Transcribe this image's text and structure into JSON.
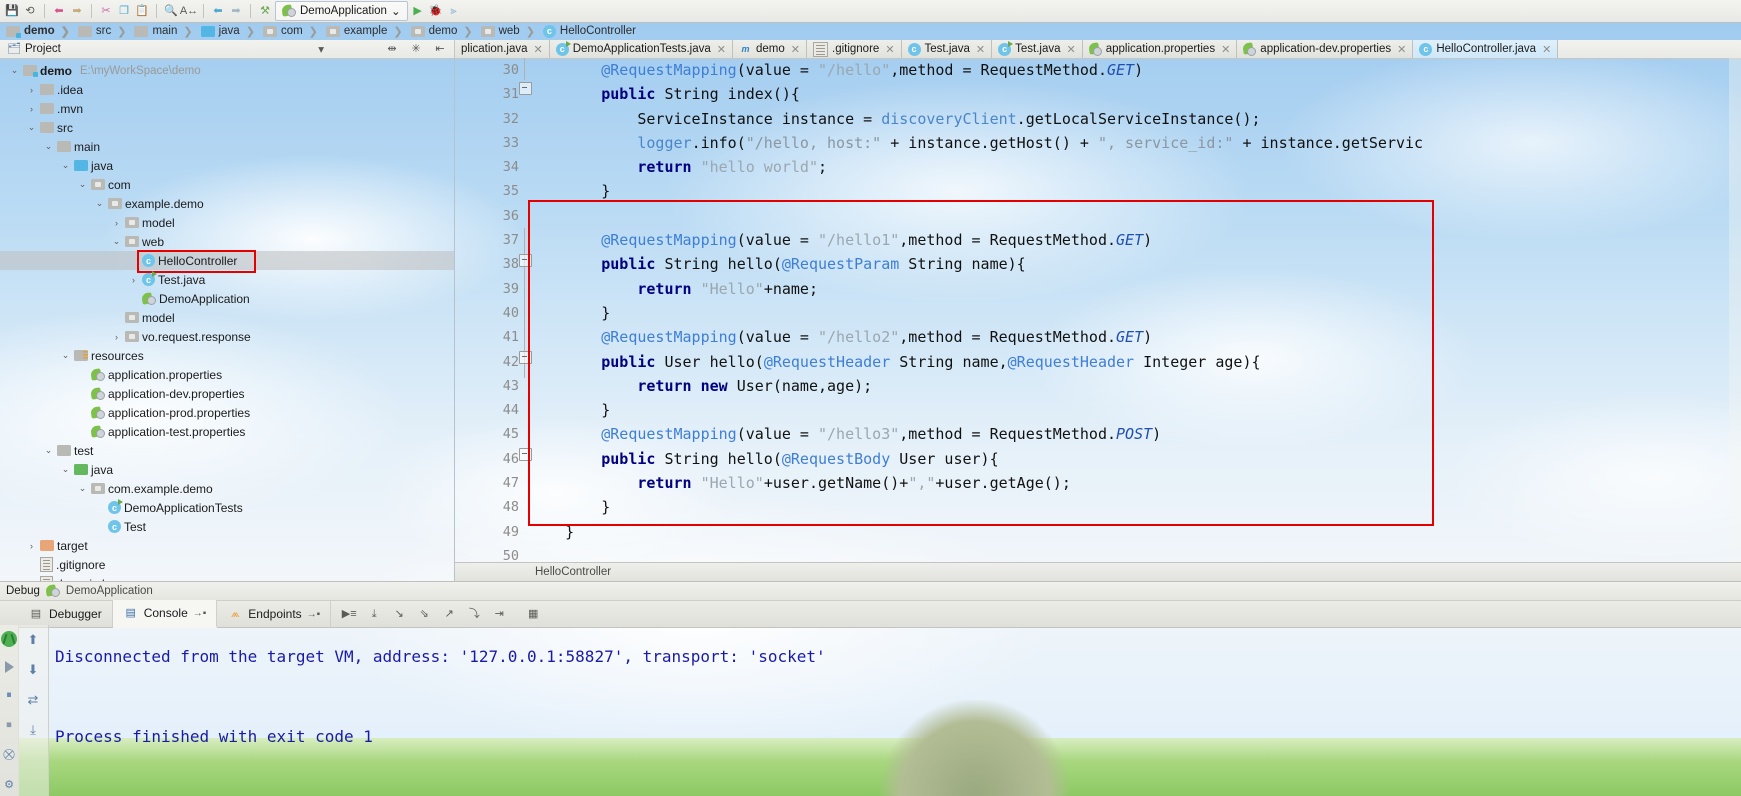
{
  "toolbar": {
    "icons": [
      "save-icon",
      "sync-icon",
      "undo-icon",
      "redo-icon",
      "cut-icon",
      "copy-icon",
      "paste-icon",
      "find-icon",
      "replace-icon",
      "back-icon",
      "forward-icon",
      "compile-icon"
    ],
    "run_config": "DemoApplication",
    "run_config_chevron": "⌄",
    "run_label": "▶",
    "debug_label": "🐞",
    "coverage_label": "⟫"
  },
  "breadcrumb": {
    "items": [
      {
        "label": "demo",
        "icon": "module-folder-icon",
        "bold": true
      },
      {
        "label": "src",
        "icon": "folder-icon",
        "bold": false
      },
      {
        "label": "main",
        "icon": "folder-icon",
        "bold": false
      },
      {
        "label": "java",
        "icon": "source-folder-icon",
        "bold": false
      },
      {
        "label": "com",
        "icon": "package-icon",
        "bold": false
      },
      {
        "label": "example",
        "icon": "package-icon",
        "bold": false
      },
      {
        "label": "demo",
        "icon": "package-icon",
        "bold": false
      },
      {
        "label": "web",
        "icon": "package-icon",
        "bold": false
      },
      {
        "label": "HelloController",
        "icon": "java-class-icon",
        "bold": false
      }
    ]
  },
  "project_panel": {
    "title": "Project",
    "chevron": "▾",
    "controls": [
      "collapse-all-icon",
      "settings-icon",
      "hide-icon"
    ]
  },
  "tabs": [
    {
      "label": "plication.java",
      "icon": "java-class-icon",
      "active": false,
      "truncated": true
    },
    {
      "label": "DemoApplicationTests.java",
      "icon": "java-test-class-icon",
      "active": false
    },
    {
      "label": "demo",
      "icon": "maven-pom-icon",
      "active": false
    },
    {
      "label": ".gitignore",
      "icon": "text-file-icon",
      "active": false
    },
    {
      "label": "Test.java",
      "icon": "java-class-icon",
      "active": false
    },
    {
      "label": "Test.java",
      "icon": "java-test-class-icon",
      "active": false
    },
    {
      "label": "application.properties",
      "icon": "spring-properties-icon",
      "active": false
    },
    {
      "label": "application-dev.properties",
      "icon": "spring-properties-icon",
      "active": false
    },
    {
      "label": "HelloController.java",
      "icon": "java-class-icon",
      "active": true
    }
  ],
  "tree": [
    {
      "indent": 0,
      "twisty": "⌄",
      "icon": "module-folder-icon",
      "label": "demo",
      "path": "E:\\myWorkSpace\\demo",
      "bold": true
    },
    {
      "indent": 1,
      "twisty": "›",
      "icon": "folder-icon",
      "label": ".idea",
      "path": "",
      "bold": false
    },
    {
      "indent": 1,
      "twisty": "›",
      "icon": "folder-icon",
      "label": ".mvn",
      "path": "",
      "bold": false
    },
    {
      "indent": 1,
      "twisty": "⌄",
      "icon": "folder-icon",
      "label": "src",
      "path": "",
      "bold": false
    },
    {
      "indent": 2,
      "twisty": "⌄",
      "icon": "folder-icon",
      "label": "main",
      "path": "",
      "bold": false
    },
    {
      "indent": 3,
      "twisty": "⌄",
      "icon": "source-folder-icon",
      "label": "java",
      "path": "",
      "bold": false
    },
    {
      "indent": 4,
      "twisty": "⌄",
      "icon": "package-icon",
      "label": "com",
      "path": "",
      "bold": false
    },
    {
      "indent": 5,
      "twisty": "⌄",
      "icon": "package-icon",
      "label": "example.demo",
      "path": "",
      "bold": false
    },
    {
      "indent": 6,
      "twisty": "›",
      "icon": "package-icon",
      "label": "model",
      "path": "",
      "bold": false
    },
    {
      "indent": 6,
      "twisty": "⌄",
      "icon": "package-icon",
      "label": "web",
      "path": "",
      "bold": false
    },
    {
      "indent": 7,
      "twisty": "",
      "icon": "java-class-icon",
      "label": "HelloController",
      "path": "",
      "bold": false,
      "selected": true,
      "highlighted": true
    },
    {
      "indent": 7,
      "twisty": "›",
      "icon": "java-test-class-icon",
      "label": "Test.java",
      "path": "",
      "bold": false
    },
    {
      "indent": 7,
      "twisty": "",
      "icon": "spring-boot-app-icon",
      "label": "DemoApplication",
      "path": "",
      "bold": false
    },
    {
      "indent": 6,
      "twisty": "",
      "icon": "package-icon",
      "label": "model",
      "path": "",
      "bold": false
    },
    {
      "indent": 6,
      "twisty": "›",
      "icon": "package-icon",
      "label": "vo.request.response",
      "path": "",
      "bold": false
    },
    {
      "indent": 3,
      "twisty": "⌄",
      "icon": "resources-folder-icon",
      "label": "resources",
      "path": "",
      "bold": false
    },
    {
      "indent": 4,
      "twisty": "",
      "icon": "spring-properties-icon",
      "label": "application.properties",
      "path": "",
      "bold": false
    },
    {
      "indent": 4,
      "twisty": "",
      "icon": "spring-properties-icon",
      "label": "application-dev.properties",
      "path": "",
      "bold": false
    },
    {
      "indent": 4,
      "twisty": "",
      "icon": "spring-properties-icon",
      "label": "application-prod.properties",
      "path": "",
      "bold": false
    },
    {
      "indent": 4,
      "twisty": "",
      "icon": "spring-properties-icon",
      "label": "application-test.properties",
      "path": "",
      "bold": false
    },
    {
      "indent": 2,
      "twisty": "⌄",
      "icon": "folder-icon",
      "label": "test",
      "path": "",
      "bold": false
    },
    {
      "indent": 3,
      "twisty": "⌄",
      "icon": "test-source-folder-icon",
      "label": "java",
      "path": "",
      "bold": false
    },
    {
      "indent": 4,
      "twisty": "⌄",
      "icon": "package-icon",
      "label": "com.example.demo",
      "path": "",
      "bold": false
    },
    {
      "indent": 5,
      "twisty": "",
      "icon": "java-test-class-icon",
      "label": "DemoApplicationTests",
      "path": "",
      "bold": false
    },
    {
      "indent": 5,
      "twisty": "",
      "icon": "java-class-icon",
      "label": "Test",
      "path": "",
      "bold": false
    },
    {
      "indent": 1,
      "twisty": "›",
      "icon": "target-folder-icon",
      "label": "target",
      "path": "",
      "bold": false
    },
    {
      "indent": 1,
      "twisty": "",
      "icon": "text-file-icon",
      "label": ".gitignore",
      "path": "",
      "bold": false
    },
    {
      "indent": 1,
      "twisty": "",
      "icon": "iml-file-icon",
      "label": "demo.iml",
      "path": "",
      "bold": false
    }
  ],
  "editor": {
    "first_line": 30,
    "status_text": "HelloController",
    "lines": [
      {
        "n": 30,
        "tokens": [
          {
            "t": "        ",
            "c": "pl"
          },
          {
            "t": "@RequestMapping",
            "c": "ann"
          },
          {
            "t": "(value = ",
            "c": "pl"
          },
          {
            "t": "\"/hello\"",
            "c": "str"
          },
          {
            "t": ",method = RequestMethod.",
            "c": "pl"
          },
          {
            "t": "GET",
            "c": "it"
          },
          {
            "t": ")",
            "c": "pl"
          }
        ]
      },
      {
        "n": 31,
        "tokens": [
          {
            "t": "        ",
            "c": "pl"
          },
          {
            "t": "public",
            "c": "k"
          },
          {
            "t": " String index(){",
            "c": "pl"
          }
        ]
      },
      {
        "n": 32,
        "tokens": [
          {
            "t": "            ServiceInstance instance = ",
            "c": "pl"
          },
          {
            "t": "discoveryClient",
            "c": "fld2"
          },
          {
            "t": ".getLocalServiceInstance();",
            "c": "pl"
          }
        ]
      },
      {
        "n": 33,
        "tokens": [
          {
            "t": "            ",
            "c": "pl"
          },
          {
            "t": "logger",
            "c": "fld2"
          },
          {
            "t": ".info(",
            "c": "pl"
          },
          {
            "t": "\"/hello, host:\"",
            "c": "st2"
          },
          {
            "t": " + instance.getHost() + ",
            "c": "pl"
          },
          {
            "t": "\", service_id:\"",
            "c": "st2"
          },
          {
            "t": " + instance.getServic",
            "c": "pl"
          }
        ]
      },
      {
        "n": 34,
        "tokens": [
          {
            "t": "            ",
            "c": "pl"
          },
          {
            "t": "return",
            "c": "k"
          },
          {
            "t": " ",
            "c": "pl"
          },
          {
            "t": "\"hello world\"",
            "c": "str"
          },
          {
            "t": ";",
            "c": "pl"
          }
        ]
      },
      {
        "n": 35,
        "tokens": [
          {
            "t": "        }",
            "c": "pl"
          }
        ]
      },
      {
        "n": 36,
        "tokens": [
          {
            "t": "",
            "c": "pl"
          }
        ]
      },
      {
        "n": 37,
        "tokens": [
          {
            "t": "        ",
            "c": "pl"
          },
          {
            "t": "@RequestMapping",
            "c": "ann"
          },
          {
            "t": "(value = ",
            "c": "pl"
          },
          {
            "t": "\"/hello1\"",
            "c": "str"
          },
          {
            "t": ",method = RequestMethod.",
            "c": "pl"
          },
          {
            "t": "GET",
            "c": "it"
          },
          {
            "t": ")",
            "c": "pl"
          }
        ]
      },
      {
        "n": 38,
        "tokens": [
          {
            "t": "        ",
            "c": "pl"
          },
          {
            "t": "public",
            "c": "k"
          },
          {
            "t": " String hello(",
            "c": "pl"
          },
          {
            "t": "@RequestParam",
            "c": "ann"
          },
          {
            "t": " String name){",
            "c": "pl"
          }
        ]
      },
      {
        "n": 39,
        "tokens": [
          {
            "t": "            ",
            "c": "pl"
          },
          {
            "t": "return",
            "c": "k"
          },
          {
            "t": " ",
            "c": "pl"
          },
          {
            "t": "\"Hello\"",
            "c": "str"
          },
          {
            "t": "+name;",
            "c": "pl"
          }
        ]
      },
      {
        "n": 40,
        "tokens": [
          {
            "t": "        }",
            "c": "pl"
          }
        ]
      },
      {
        "n": 41,
        "tokens": [
          {
            "t": "        ",
            "c": "pl"
          },
          {
            "t": "@RequestMapping",
            "c": "ann"
          },
          {
            "t": "(value = ",
            "c": "pl"
          },
          {
            "t": "\"/hello2\"",
            "c": "str"
          },
          {
            "t": ",method = RequestMethod.",
            "c": "pl"
          },
          {
            "t": "GET",
            "c": "it"
          },
          {
            "t": ")",
            "c": "pl"
          }
        ]
      },
      {
        "n": 42,
        "tokens": [
          {
            "t": "        ",
            "c": "pl"
          },
          {
            "t": "public",
            "c": "k"
          },
          {
            "t": " User hello(",
            "c": "pl"
          },
          {
            "t": "@RequestHeader",
            "c": "ann"
          },
          {
            "t": " String name,",
            "c": "pl"
          },
          {
            "t": "@RequestHeader",
            "c": "ann"
          },
          {
            "t": " Integer age){",
            "c": "pl"
          }
        ]
      },
      {
        "n": 43,
        "tokens": [
          {
            "t": "            ",
            "c": "pl"
          },
          {
            "t": "return",
            "c": "k"
          },
          {
            "t": " ",
            "c": "pl"
          },
          {
            "t": "new",
            "c": "k"
          },
          {
            "t": " User(name,age);",
            "c": "pl"
          }
        ]
      },
      {
        "n": 44,
        "tokens": [
          {
            "t": "        }",
            "c": "pl"
          }
        ]
      },
      {
        "n": 45,
        "tokens": [
          {
            "t": "        ",
            "c": "pl"
          },
          {
            "t": "@RequestMapping",
            "c": "ann"
          },
          {
            "t": "(value = ",
            "c": "pl"
          },
          {
            "t": "\"/hello3\"",
            "c": "str"
          },
          {
            "t": ",method = RequestMethod.",
            "c": "pl"
          },
          {
            "t": "POST",
            "c": "it"
          },
          {
            "t": ")",
            "c": "pl"
          }
        ]
      },
      {
        "n": 46,
        "tokens": [
          {
            "t": "        ",
            "c": "pl"
          },
          {
            "t": "public",
            "c": "k"
          },
          {
            "t": " String hello(",
            "c": "pl"
          },
          {
            "t": "@RequestBody",
            "c": "ann"
          },
          {
            "t": " User user){",
            "c": "pl"
          }
        ]
      },
      {
        "n": 47,
        "tokens": [
          {
            "t": "            ",
            "c": "pl"
          },
          {
            "t": "return",
            "c": "k"
          },
          {
            "t": " ",
            "c": "pl"
          },
          {
            "t": "\"Hello\"",
            "c": "str"
          },
          {
            "t": "+user.getName()+",
            "c": "pl"
          },
          {
            "t": "\",\"",
            "c": "str"
          },
          {
            "t": "+user.getAge();",
            "c": "pl"
          }
        ]
      },
      {
        "n": 48,
        "tokens": [
          {
            "t": "        }",
            "c": "pl"
          }
        ]
      },
      {
        "n": 49,
        "tokens": [
          {
            "t": "    }",
            "c": "pl"
          }
        ]
      },
      {
        "n": 50,
        "tokens": [
          {
            "t": "",
            "c": "pl"
          }
        ]
      }
    ]
  },
  "debug": {
    "title_label": "Debug",
    "config_name": "DemoApplication",
    "tabs": [
      {
        "label": "Debugger",
        "icon": "debugger-icon",
        "active": false
      },
      {
        "label": "Console",
        "icon": "console-icon",
        "active": true,
        "pin": "→▪"
      },
      {
        "label": "Endpoints",
        "icon": "endpoints-icon",
        "active": false,
        "pin": "→▪"
      }
    ],
    "tool_icons": [
      "rerun-icon",
      "step-over-icon",
      "step-into-icon",
      "force-step-into-icon",
      "step-out-icon",
      "drop-frame-icon",
      "run-to-cursor-icon",
      "evaluate-icon"
    ],
    "console_lines": [
      "Disconnected from the target VM, address: '127.0.0.1:58827', transport: 'socket'",
      "",
      "Process finished with exit code 1"
    ],
    "side_icons": [
      "debug-bug-icon",
      "resume-icon",
      "pause-icon",
      "stop-icon",
      "mute-breakpoints-icon",
      "settings-icon"
    ],
    "console_gutter_icons": [
      "scroll-up-icon",
      "scroll-down-icon",
      "soft-wrap-icon",
      "scroll-end-icon"
    ]
  },
  "colors": {
    "annotation_box": "#e50000",
    "annotation_blue": "#3e7ed6",
    "keyword": "#000080",
    "string": "#9aa7b0",
    "console_text": "#1a1aa8",
    "tab_active_bg": "#cfe7f8"
  }
}
